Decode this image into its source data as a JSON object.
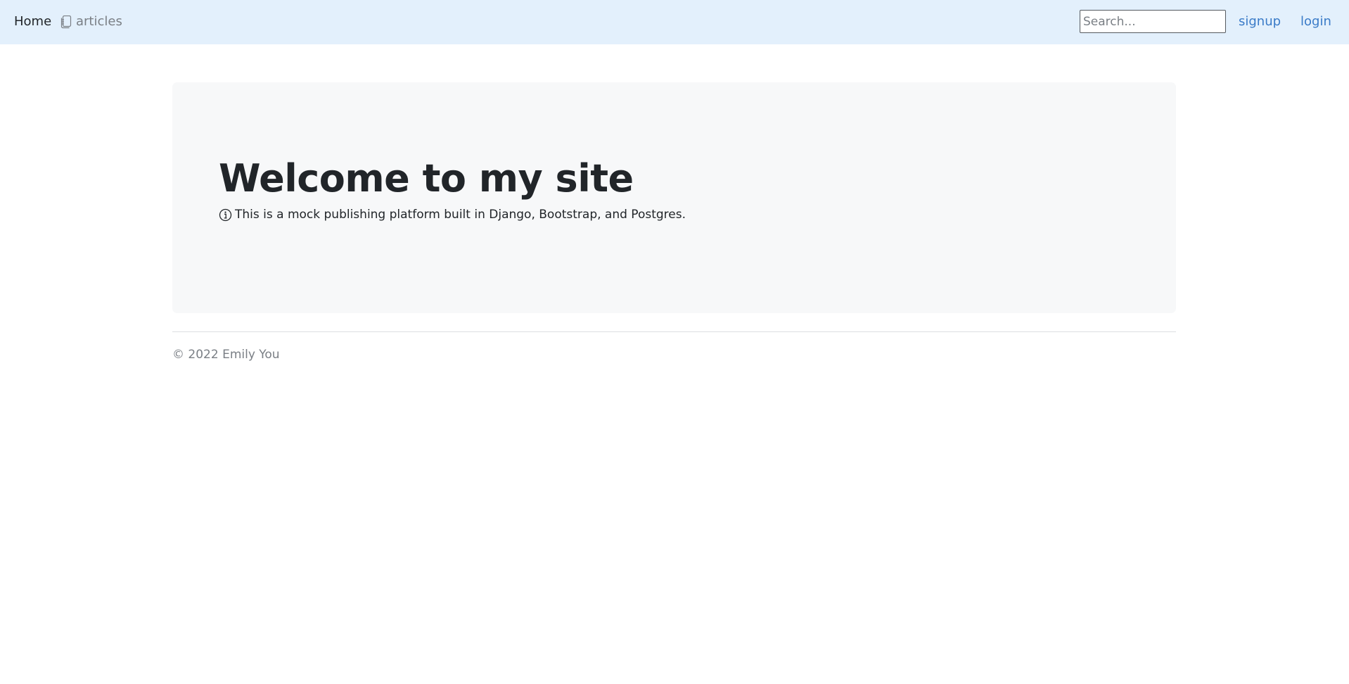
{
  "navbar": {
    "home_label": "Home",
    "articles_label": "articles",
    "articles_icon": "journals-icon",
    "search_placeholder": "Search...",
    "search_value": "",
    "signup_label": "signup",
    "login_label": "login",
    "background_color": "#e3f0fc",
    "link_color": "#3a7bc8"
  },
  "hero": {
    "title": "Welcome to my site",
    "subtitle": "This is a mock publishing platform built in Django, Bootstrap, and Postgres.",
    "info_icon": "info-circle-icon",
    "background_color": "#f7f8f9"
  },
  "footer": {
    "copyright": "© 2022 Emily You"
  }
}
